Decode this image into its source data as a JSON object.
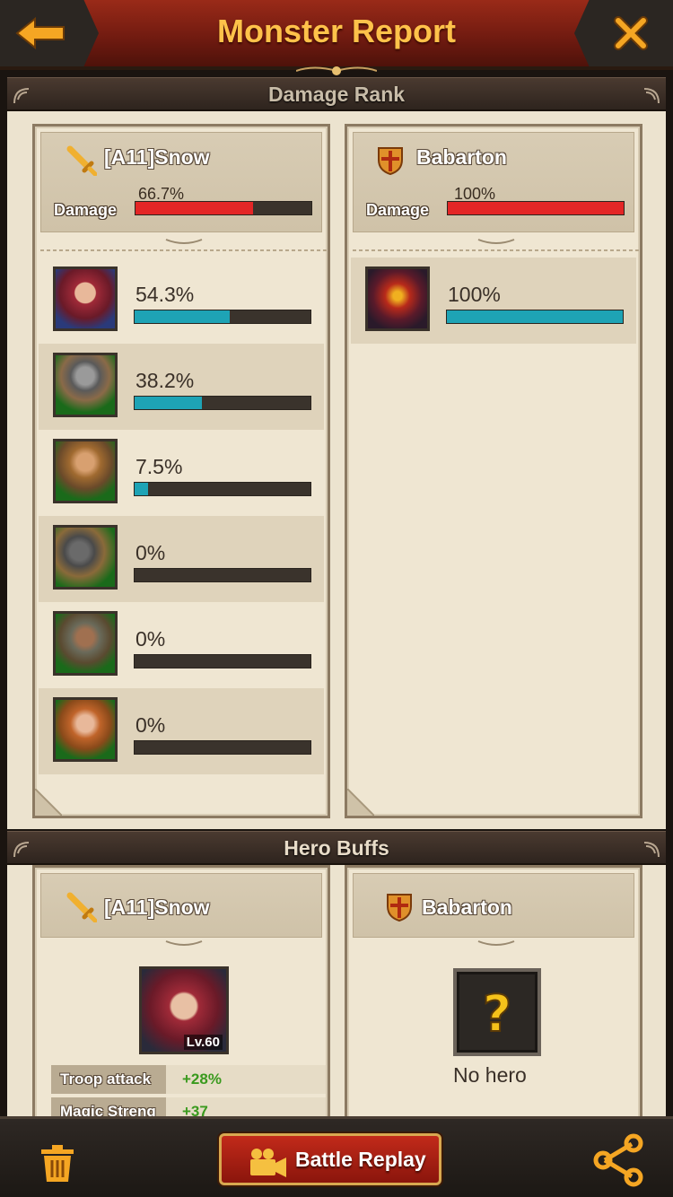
{
  "header": {
    "title": "Monster Report"
  },
  "damage_rank": {
    "title": "Damage Rank",
    "attacker": {
      "name": "[A11]Snow",
      "damage_label": "Damage",
      "damage_pct": "66.7%",
      "damage_fraction": 0.667,
      "heroes": [
        {
          "pct": "54.3%",
          "fraction": 0.543
        },
        {
          "pct": "38.2%",
          "fraction": 0.382
        },
        {
          "pct": "7.5%",
          "fraction": 0.075
        },
        {
          "pct": "0%",
          "fraction": 0
        },
        {
          "pct": "0%",
          "fraction": 0
        },
        {
          "pct": "0%",
          "fraction": 0
        }
      ]
    },
    "defender": {
      "name": "Babarton",
      "damage_label": "Damage",
      "damage_pct": "100%",
      "damage_fraction": 1.0,
      "units": [
        {
          "pct": "100%",
          "fraction": 1.0
        }
      ]
    }
  },
  "hero_buffs": {
    "title": "Hero Buffs",
    "attacker": {
      "name": "[A11]Snow",
      "hero_level": "Lv.60",
      "buffs": [
        {
          "label": "Troop attack",
          "value": "+28%"
        },
        {
          "label": "Magic Streng",
          "value": "+37"
        }
      ]
    },
    "defender": {
      "name": "Babarton",
      "no_hero": "No hero"
    }
  },
  "bottom": {
    "battle_replay": "Battle Replay"
  },
  "colors": {
    "accent": "#ffc24a",
    "damage_red": "#e32626",
    "hero_teal": "#1ea3b5",
    "buff_green": "#3a9a1e"
  }
}
